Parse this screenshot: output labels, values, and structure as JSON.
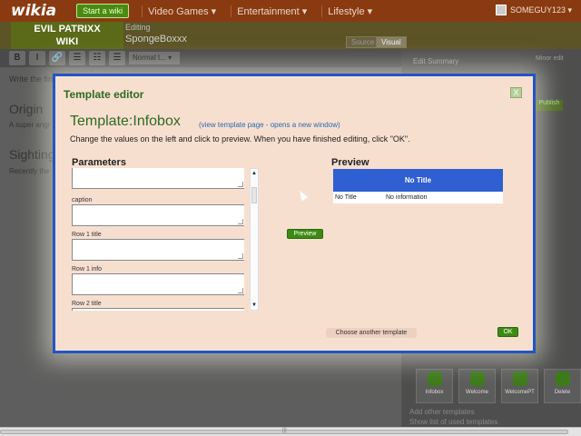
{
  "topbar": {
    "logo": "wikia",
    "start_wiki": "Start a wiki",
    "nav": [
      "Video Games ▾",
      "Entertainment ▾",
      "Lifestyle ▾"
    ],
    "username": "SOMEGUY123 ▾"
  },
  "wiki": {
    "name_line1": "EVIL PATRIXX",
    "name_line2": "WIKI",
    "editing_label": "Editing",
    "editing_title": "SpongeBoxxx",
    "tab_source": "Source",
    "tab_visual": "Visual"
  },
  "toolbar": {
    "buttons": [
      "B",
      "I",
      "🔗",
      "☰",
      "☷",
      "☰"
    ],
    "format_select": "Normal t... ▾"
  },
  "editor": {
    "hint": "Write the firs",
    "heading1": "Origin",
    "para1": "A super angr",
    "heading2": "Sightings",
    "para2": "Recently the"
  },
  "rightpanel": {
    "summary_label": "Edit Summary",
    "minor_edit": "Minor edit",
    "publish": "Publish",
    "templates": [
      "Infobox",
      "Welcome",
      "WelcomePT",
      "Delete"
    ],
    "add_other": "Add other templates",
    "show_full": "Show list of used templates"
  },
  "modal": {
    "title": "Template editor",
    "close_label": "X",
    "template_name": "Template:Infobox",
    "template_link": "(view template page - opens a new window)",
    "instructions": "Change the values on the left and click to preview. When you have finished editing, click \"OK\".",
    "params_heading": "Parameters",
    "params": [
      {
        "label": "",
        "value": ""
      },
      {
        "label": "caption",
        "value": ""
      },
      {
        "label": "Row 1 title",
        "value": ""
      },
      {
        "label": "Row 1 info",
        "value": ""
      },
      {
        "label": "Row 2 title",
        "value": ""
      }
    ],
    "preview_button": "Preview",
    "preview_heading": "Preview",
    "infobox_title": "No Title",
    "infobox_key": "No Title",
    "infobox_value": "No information",
    "choose_button": "Choose another template",
    "ok_button": "OK"
  }
}
